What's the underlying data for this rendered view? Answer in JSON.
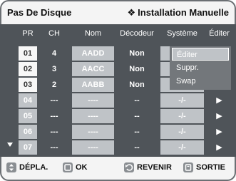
{
  "header": {
    "title": "Pas De Disque",
    "symbol": "❖",
    "right": "Installation Manuelle"
  },
  "columns": {
    "pr": "PR",
    "ch": "CH",
    "nom": "Nom",
    "decodeur": "Décodeur",
    "systeme": "Système",
    "editer": "Éditer"
  },
  "rows": [
    {
      "pr": "01",
      "ch": "4",
      "nom": "AADD",
      "decodeur": "Non",
      "systeme": "",
      "editer": ""
    },
    {
      "pr": "02",
      "ch": "3",
      "nom": "AACC",
      "decodeur": "Non",
      "systeme": "",
      "editer": ""
    },
    {
      "pr": "03",
      "ch": "2",
      "nom": "AABB",
      "decodeur": "Non",
      "systeme": "",
      "editer": ""
    },
    {
      "pr": "04",
      "ch": "---",
      "nom": "----",
      "decodeur": "--",
      "systeme": "-/-",
      "editer": "▶"
    },
    {
      "pr": "05",
      "ch": "---",
      "nom": "----",
      "decodeur": "--",
      "systeme": "-/-",
      "editer": "▶"
    },
    {
      "pr": "06",
      "ch": "---",
      "nom": "----",
      "decodeur": "--",
      "systeme": "-/-",
      "editer": "▶"
    },
    {
      "pr": "07",
      "ch": "---",
      "nom": "----",
      "decodeur": "--",
      "systeme": "-/-",
      "editer": "▶"
    }
  ],
  "popup": {
    "items": [
      "Éditer",
      "Suppr.",
      "Swap"
    ]
  },
  "footer": {
    "move": "DÉPLA.",
    "ok": "OK",
    "back": "REVENIR",
    "exit": "SORTIE"
  }
}
